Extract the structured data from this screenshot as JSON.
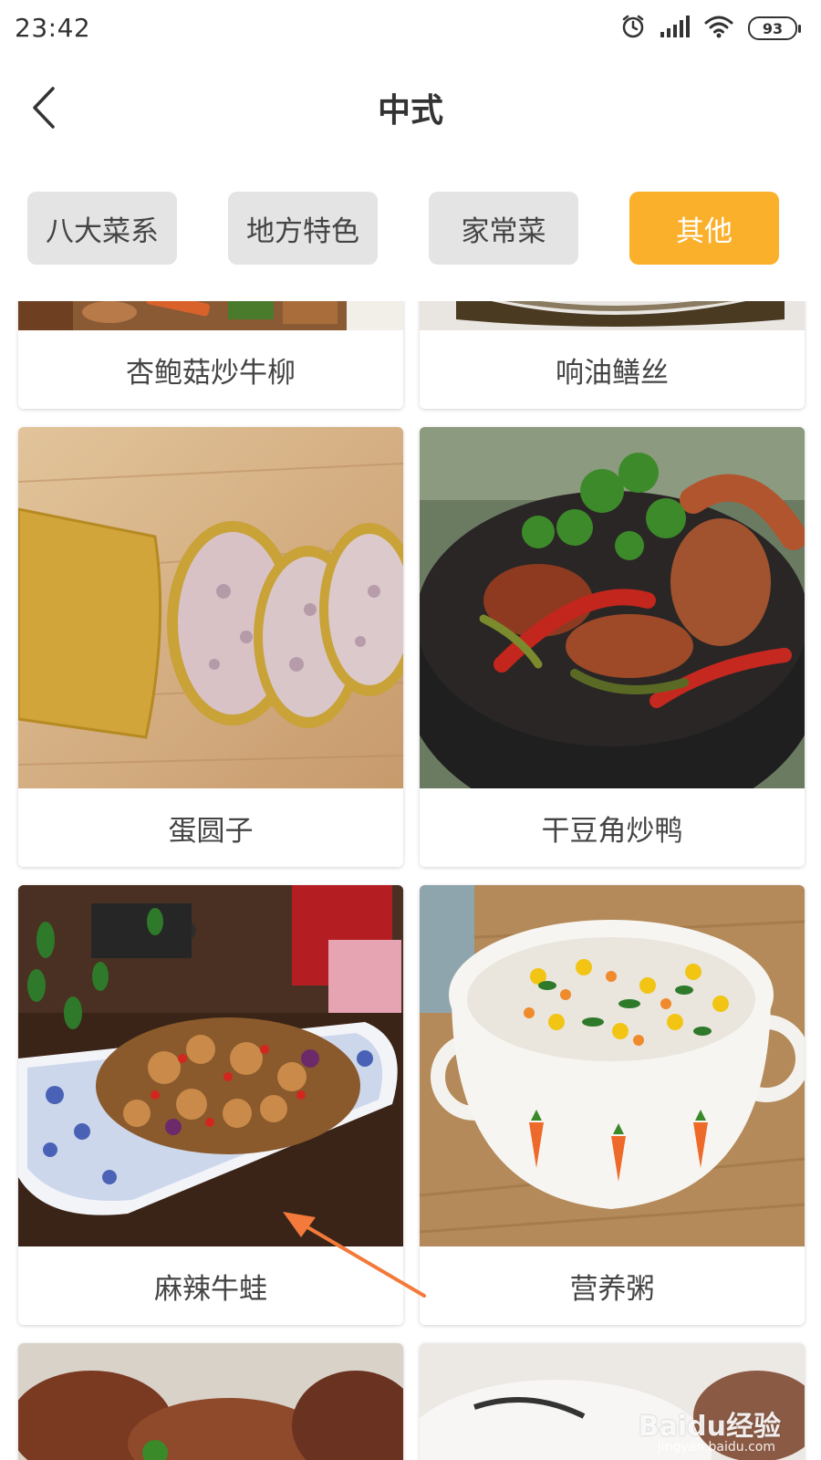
{
  "status_bar": {
    "time": "23:42",
    "battery": "93",
    "icons": [
      "alarm-icon",
      "signal-icon",
      "wifi-icon",
      "battery-icon"
    ]
  },
  "header": {
    "title": "中式",
    "back_icon": "chevron-left-icon"
  },
  "tabs": [
    {
      "label": "八大菜系",
      "active": false
    },
    {
      "label": "地方特色",
      "active": false
    },
    {
      "label": "家常菜",
      "active": false
    },
    {
      "label": "其他",
      "active": true
    }
  ],
  "colors": {
    "accent": "#fbb02b",
    "tab_inactive": "#e4e4e4",
    "annotation_arrow": "#f37a3a"
  },
  "dishes": [
    {
      "name": "杏鲍菇炒牛柳"
    },
    {
      "name": "响油鳝丝"
    },
    {
      "name": "蛋圆子"
    },
    {
      "name": "干豆角炒鸭"
    },
    {
      "name": "麻辣牛蛙"
    },
    {
      "name": "营养粥"
    }
  ],
  "watermark": {
    "brand": "Baidu经验",
    "url": "jingyan.baidu.com"
  }
}
